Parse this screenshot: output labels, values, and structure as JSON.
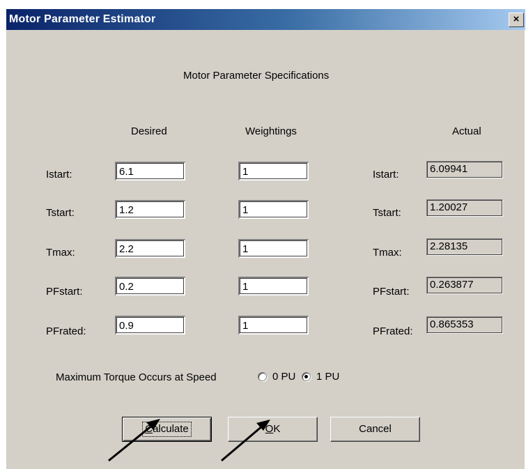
{
  "window": {
    "title": "Motor Parameter Estimator",
    "close_glyph": "×"
  },
  "section_title": "Motor Parameter Specifications",
  "columns": {
    "desired": "Desired",
    "weightings": "Weightings",
    "actual": "Actual"
  },
  "rows": [
    {
      "label": "Istart:",
      "desired": "6.1",
      "weighting": "1",
      "actual_label": "Istart:",
      "actual": "6.09941"
    },
    {
      "label": "Tstart:",
      "desired": "1.2",
      "weighting": "1",
      "actual_label": "Tstart:",
      "actual": "1.20027"
    },
    {
      "label": "Tmax:",
      "desired": "2.2",
      "weighting": "1",
      "actual_label": "Tmax:",
      "actual": "2.28135"
    },
    {
      "label": "PFstart:",
      "desired": "0.2",
      "weighting": "1",
      "actual_label": "PFstart:",
      "actual": "0.263877"
    },
    {
      "label": "PFrated:",
      "desired": "0.9",
      "weighting": "1",
      "actual_label": "PFrated:",
      "actual": "0.865353"
    }
  ],
  "torque_speed": {
    "label": "Maximum Torque Occurs at Speed",
    "options": [
      {
        "label": "0 PU",
        "selected": false
      },
      {
        "label": "1 PU",
        "selected": true
      }
    ]
  },
  "buttons": {
    "calculate": "Calculate",
    "ok": "OK",
    "cancel": "Cancel"
  },
  "icons": {
    "close": "close-icon",
    "annotation": "arrow-icon"
  },
  "colors": {
    "titlebar_start": "#0a246a",
    "titlebar_end": "#a6caf0",
    "dialog_bg": "#d4d0c8"
  }
}
